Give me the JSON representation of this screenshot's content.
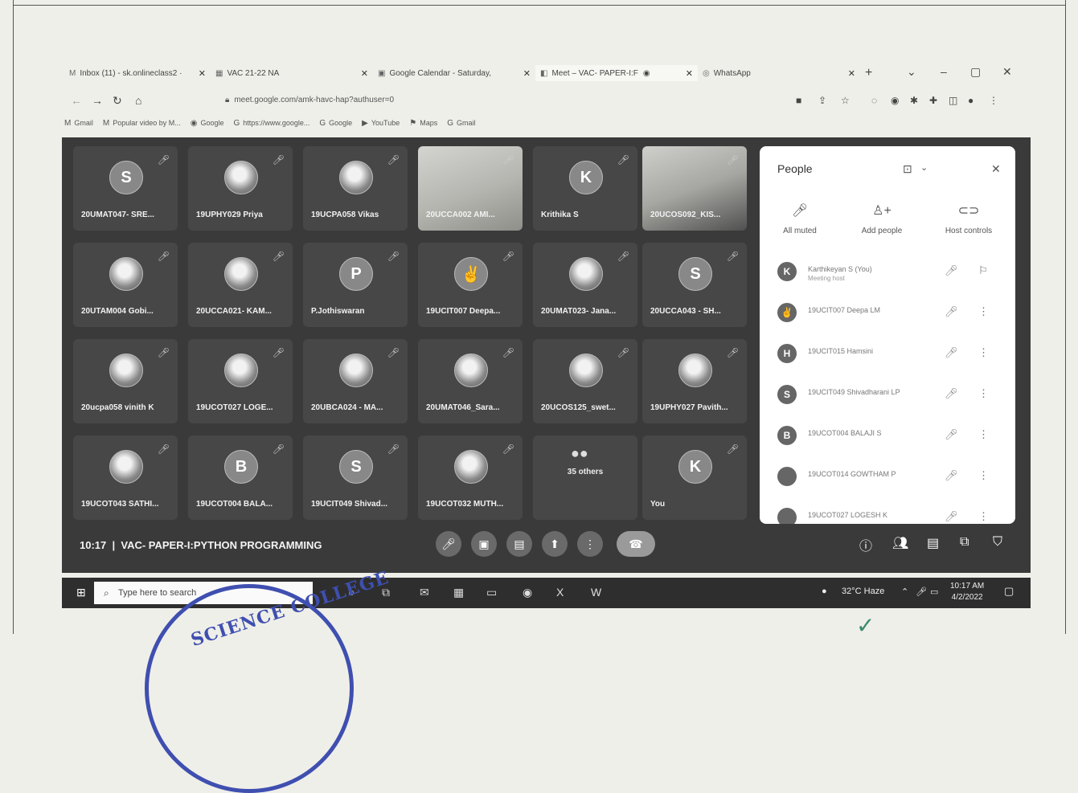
{
  "browser": {
    "tabs": [
      {
        "icon": "gmail-icon",
        "label": "Inbox (11) - sk.onlineclass2 ·",
        "active": false
      },
      {
        "icon": "drive-icon",
        "label": "VAC 21-22 NA",
        "active": false
      },
      {
        "icon": "calendar-icon",
        "label": "Google Calendar - Saturday,",
        "active": false
      },
      {
        "icon": "meet-icon",
        "label": "Meet – VAC- PAPER-I:F",
        "active": true
      },
      {
        "icon": "whatsapp-icon",
        "label": "WhatsApp",
        "active": false
      }
    ],
    "url": "meet.google.com/amk-havc-hap?authuser=0",
    "bookmarks": [
      {
        "icon": "gmail-icon",
        "label": "Gmail"
      },
      {
        "icon": "gmail-icon",
        "label": "Popular video by M..."
      },
      {
        "icon": "google-icon",
        "label": "Google"
      },
      {
        "icon": "google-icon",
        "label": "https://www.google..."
      },
      {
        "icon": "google-icon",
        "label": "Google"
      },
      {
        "icon": "youtube-icon",
        "label": "YouTube"
      },
      {
        "icon": "maps-icon",
        "label": "Maps"
      },
      {
        "icon": "google-icon",
        "label": "Gmail"
      }
    ]
  },
  "meet": {
    "tiles": [
      {
        "name": "20UMAT047- SRE...",
        "avatar": "S",
        "type": "letter"
      },
      {
        "name": "19UPHY029 Priya",
        "avatar": "",
        "type": "pic"
      },
      {
        "name": "19UCPA058 Vikas",
        "avatar": "",
        "type": "pic"
      },
      {
        "name": "20UCCA002 AMI...",
        "avatar": "",
        "type": "photo"
      },
      {
        "name": "Krithika S",
        "avatar": "K",
        "type": "letter"
      },
      {
        "name": "20UCOS092_KIS...",
        "avatar": "",
        "type": "photo2"
      },
      {
        "name": "20UTAM004 Gobi...",
        "avatar": "",
        "type": "pic"
      },
      {
        "name": "20UCCA021- KAM...",
        "avatar": "",
        "type": "pic"
      },
      {
        "name": "P.Jothiswaran",
        "avatar": "P",
        "type": "letter"
      },
      {
        "name": "19UCIT007 Deepa...",
        "avatar": "✌",
        "type": "letter"
      },
      {
        "name": "20UMAT023- Jana...",
        "avatar": "",
        "type": "pic"
      },
      {
        "name": "20UCCA043 - SH...",
        "avatar": "S",
        "type": "letter"
      },
      {
        "name": "20ucpa058 vinith K",
        "avatar": "",
        "type": "pic"
      },
      {
        "name": "19UCOT027 LOGE...",
        "avatar": "",
        "type": "pic"
      },
      {
        "name": "20UBCA024 - MA...",
        "avatar": "",
        "type": "pic"
      },
      {
        "name": "20UMAT046_Sara...",
        "avatar": "",
        "type": "pic"
      },
      {
        "name": "20UCOS125_swet...",
        "avatar": "",
        "type": "pic"
      },
      {
        "name": "19UPHY027 Pavith...",
        "avatar": "",
        "type": "pic"
      },
      {
        "name": "19UCOT043 SATHI...",
        "avatar": "",
        "type": "pic"
      },
      {
        "name": "19UCOT004 BALA...",
        "avatar": "B",
        "type": "letter"
      },
      {
        "name": "19UCIT049 Shivad...",
        "avatar": "S",
        "type": "letter"
      },
      {
        "name": "19UCOT032 MUTH...",
        "avatar": "",
        "type": "pic"
      },
      {
        "name": "35 others",
        "avatar": "",
        "type": "others"
      },
      {
        "name": "You",
        "avatar": "K",
        "type": "letter"
      }
    ],
    "time": "10:17",
    "separator": "|",
    "meeting_title": "VAC- PAPER-I:PYTHON PROGRAMMING",
    "people_panel": {
      "title": "People",
      "actions": [
        {
          "icon": "mic-off-icon",
          "label": "All muted"
        },
        {
          "icon": "add-person-icon",
          "label": "Add people"
        },
        {
          "icon": "toggle-icon",
          "label": "Host controls"
        }
      ],
      "participants": [
        {
          "avatar": "K",
          "name": "Karthikeyan S (You)",
          "sub": "Meeting host"
        },
        {
          "avatar": "✌",
          "name": "19UCIT007 Deepa LM",
          "sub": ""
        },
        {
          "avatar": "H",
          "name": "19UCIT015 Hamsini",
          "sub": ""
        },
        {
          "avatar": "S",
          "name": "19UCIT049 Shivadharani LP",
          "sub": ""
        },
        {
          "avatar": "B",
          "name": "19UCOT004 BALAJI S",
          "sub": ""
        },
        {
          "avatar": "",
          "name": "19UCOT014 GOWTHAM P",
          "sub": ""
        },
        {
          "avatar": "",
          "name": "19UCOT027 LOGESH K",
          "sub": ""
        }
      ]
    },
    "others_count_label": "35 others"
  },
  "taskbar": {
    "search_placeholder": "Type here to search",
    "weather": "32°C Haze",
    "time": "10:17 AM",
    "date": "4/2/2022"
  },
  "stamp_text": "SCIENCE COLLEGE"
}
